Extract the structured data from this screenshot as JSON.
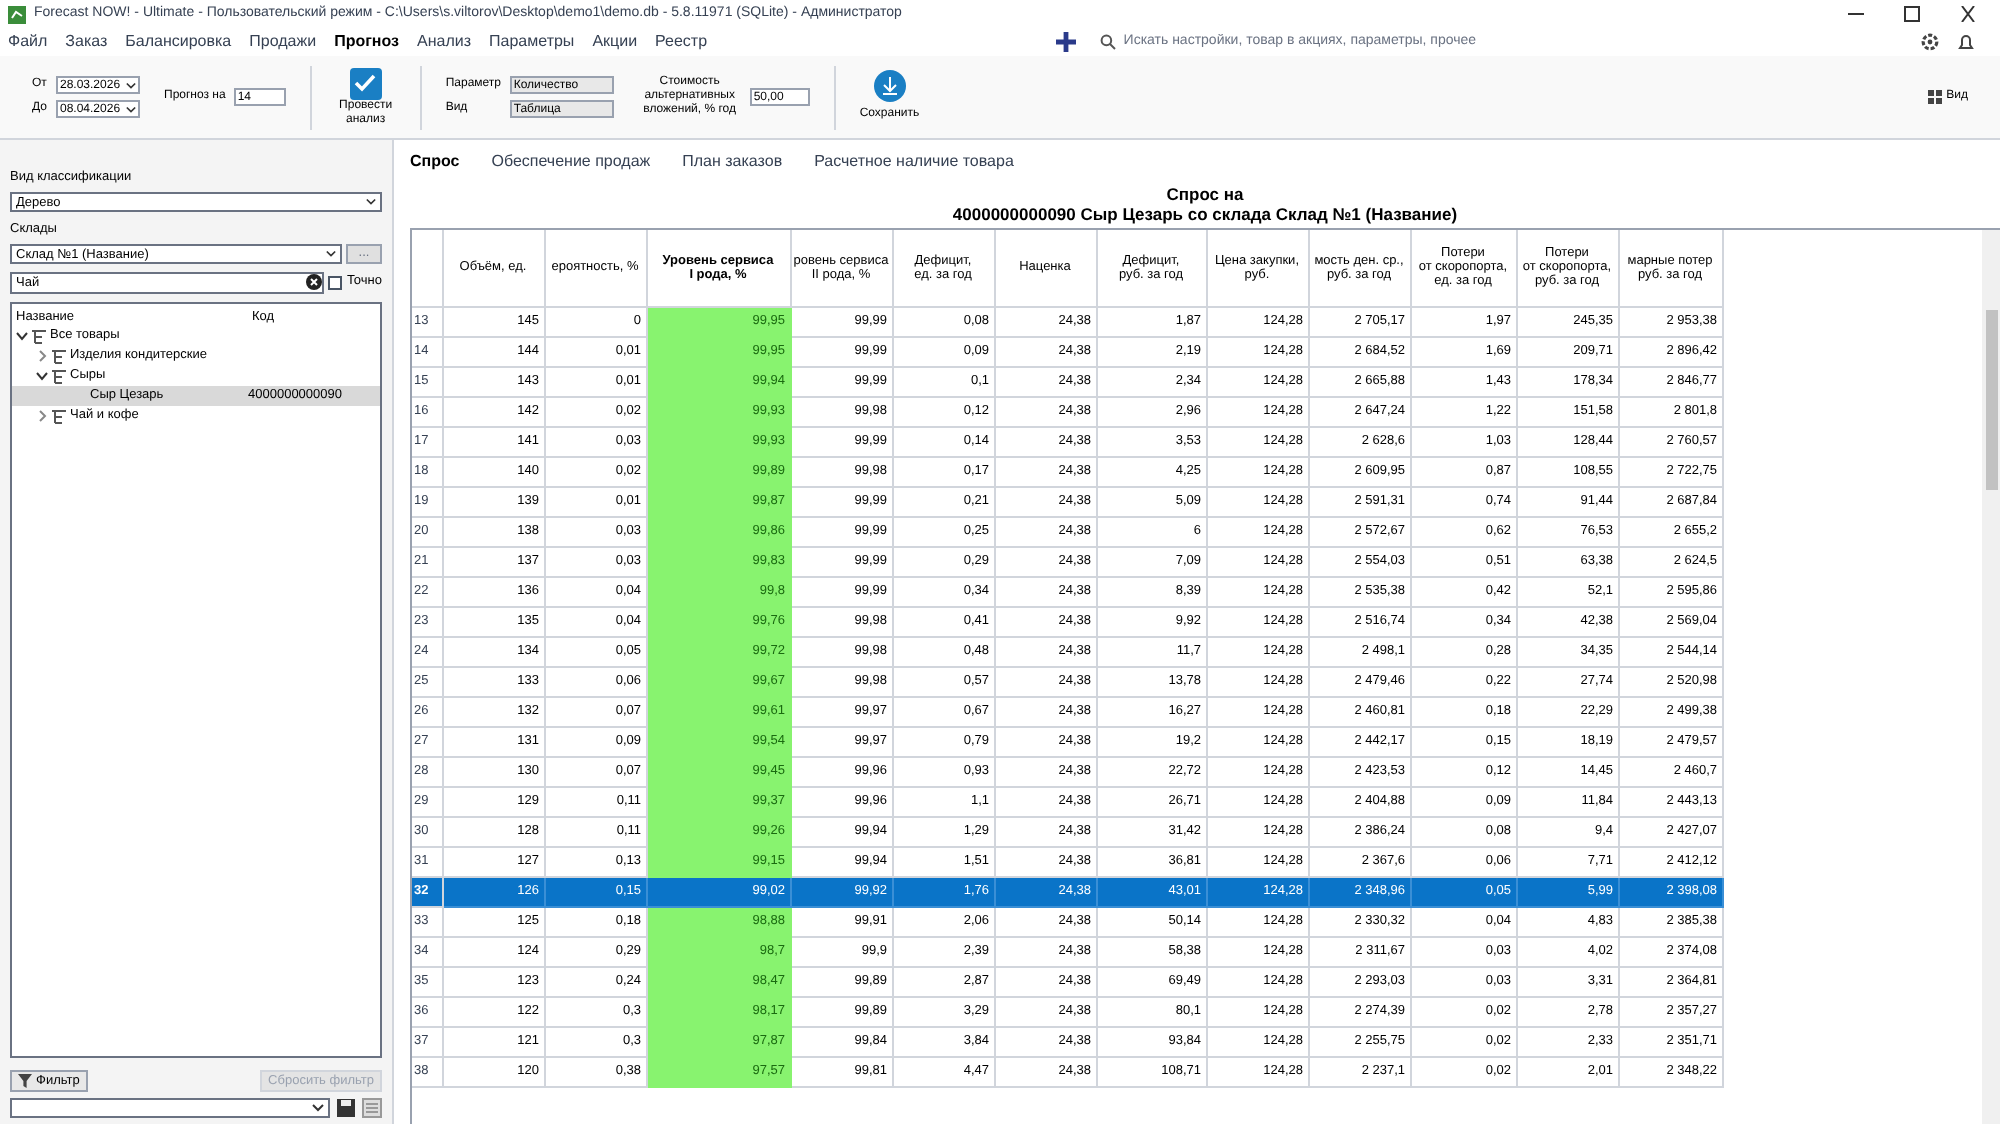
{
  "window": {
    "title": "Forecast NOW! - Ultimate - Пользовательский режим - C:\\Users\\s.viltorov\\Desktop\\demo1\\demo.db - 5.8.11971 (SQLite) - Администратор"
  },
  "menu": [
    {
      "label": "Файл",
      "selected": false
    },
    {
      "label": "Заказ",
      "selected": false
    },
    {
      "label": "Балансировка",
      "selected": false
    },
    {
      "label": "Продажи",
      "selected": false
    },
    {
      "label": "Прогноз",
      "selected": true
    },
    {
      "label": "Анализ",
      "selected": false
    },
    {
      "label": "Параметры",
      "selected": false
    },
    {
      "label": "Акции",
      "selected": false
    },
    {
      "label": "Реестр",
      "selected": false
    }
  ],
  "search": {
    "placeholder": "Искать настройки, товар в акциях, параметры, прочее"
  },
  "toolbar": {
    "from_label": "От",
    "from": "28.03.2026",
    "to_label": "До",
    "to": "08.04.2026",
    "forecast_label": "Прогноз на",
    "forecast": "14",
    "analyze": {
      "label": "Провести анализ",
      "checked": true
    },
    "param_label": "Параметр",
    "param": "Количество",
    "view_label": "Вид",
    "view": "Таблица",
    "rate_label": "Стоимость альтернативных вложений, % год",
    "rate": "50,00",
    "save": "Сохранить",
    "view_menu": "Вид"
  },
  "sidebar": {
    "classification_label": "Вид классификации",
    "classification": "Дерево",
    "warehouses_label": "Склады",
    "warehouse": "Склад №1 (Название)",
    "browse": "...",
    "filter_value": "Чай",
    "exact": {
      "label": "Точно",
      "checked": false
    },
    "tree_columns": [
      "Название",
      "Код"
    ],
    "tree": [
      {
        "name": "Все товары",
        "expanded": true,
        "selected": false,
        "children": [
          {
            "name": "Изделия кондитерские",
            "expanded": false,
            "selected": false
          },
          {
            "name": "Сыры",
            "expanded": true,
            "selected": false,
            "children": [
              {
                "name": "Сыр Цезарь",
                "code": "4000000000090",
                "selected": true
              }
            ]
          },
          {
            "name": "Чай и кофе",
            "expanded": false,
            "selected": false
          }
        ]
      }
    ],
    "filter_button": "Фильтр",
    "reset_button": {
      "label": "Сбросить фильтр",
      "disabled": true
    }
  },
  "tabs": [
    {
      "label": "Спрос",
      "selected": true
    },
    {
      "label": "Обеспечение продаж",
      "selected": false
    },
    {
      "label": "План заказов",
      "selected": false
    },
    {
      "label": "Расчетное наличие товара",
      "selected": false
    }
  ],
  "report_title": [
    "Спрос на",
    "4000000000090 Сыр Цезарь со склада Склад №1 (Название)"
  ],
  "table": {
    "columns": [
      {
        "label": "Объём, ед.",
        "highlighted": false
      },
      {
        "label": "ероятность, %",
        "highlighted": false
      },
      {
        "label": "Уровень сервиса\nI рода, %",
        "highlighted": true
      },
      {
        "label": "ровень сервиса\nII рода, %",
        "highlighted": false
      },
      {
        "label": "Дефицит,\nед. за год",
        "highlighted": false
      },
      {
        "label": "Наценка",
        "highlighted": false
      },
      {
        "label": "Дефицит,\nруб. за год",
        "highlighted": false
      },
      {
        "label": "Цена закупки,\nруб.",
        "highlighted": false
      },
      {
        "label": "мость ден. ср.,\nруб. за год",
        "highlighted": false
      },
      {
        "label": "Потери\nот скоропорта,\nед. за год",
        "highlighted": false
      },
      {
        "label": "Потери\nот скоропорта,\nруб. за год",
        "highlighted": false
      },
      {
        "label": "марные потер\nруб. за год",
        "highlighted": false
      }
    ],
    "rows": [
      {
        "number": "13",
        "selected": false,
        "cells": [
          "145",
          "0",
          "99,95",
          "99,99",
          "0,08",
          "24,38",
          "1,87",
          "124,28",
          "2 705,17",
          "1,97",
          "245,35",
          "2 953,38"
        ]
      },
      {
        "number": "14",
        "selected": false,
        "cells": [
          "144",
          "0,01",
          "99,95",
          "99,99",
          "0,09",
          "24,38",
          "2,19",
          "124,28",
          "2 684,52",
          "1,69",
          "209,71",
          "2 896,42"
        ]
      },
      {
        "number": "15",
        "selected": false,
        "cells": [
          "143",
          "0,01",
          "99,94",
          "99,99",
          "0,1",
          "24,38",
          "2,34",
          "124,28",
          "2 665,88",
          "1,43",
          "178,34",
          "2 846,77"
        ]
      },
      {
        "number": "16",
        "selected": false,
        "cells": [
          "142",
          "0,02",
          "99,93",
          "99,98",
          "0,12",
          "24,38",
          "2,96",
          "124,28",
          "2 647,24",
          "1,22",
          "151,58",
          "2 801,8"
        ]
      },
      {
        "number": "17",
        "selected": false,
        "cells": [
          "141",
          "0,03",
          "99,93",
          "99,99",
          "0,14",
          "24,38",
          "3,53",
          "124,28",
          "2 628,6",
          "1,03",
          "128,44",
          "2 760,57"
        ]
      },
      {
        "number": "18",
        "selected": false,
        "cells": [
          "140",
          "0,02",
          "99,89",
          "99,98",
          "0,17",
          "24,38",
          "4,25",
          "124,28",
          "2 609,95",
          "0,87",
          "108,55",
          "2 722,75"
        ]
      },
      {
        "number": "19",
        "selected": false,
        "cells": [
          "139",
          "0,01",
          "99,87",
          "99,99",
          "0,21",
          "24,38",
          "5,09",
          "124,28",
          "2 591,31",
          "0,74",
          "91,44",
          "2 687,84"
        ]
      },
      {
        "number": "20",
        "selected": false,
        "cells": [
          "138",
          "0,03",
          "99,86",
          "99,99",
          "0,25",
          "24,38",
          "6",
          "124,28",
          "2 572,67",
          "0,62",
          "76,53",
          "2 655,2"
        ]
      },
      {
        "number": "21",
        "selected": false,
        "cells": [
          "137",
          "0,03",
          "99,83",
          "99,99",
          "0,29",
          "24,38",
          "7,09",
          "124,28",
          "2 554,03",
          "0,51",
          "63,38",
          "2 624,5"
        ]
      },
      {
        "number": "22",
        "selected": false,
        "cells": [
          "136",
          "0,04",
          "99,8",
          "99,99",
          "0,34",
          "24,38",
          "8,39",
          "124,28",
          "2 535,38",
          "0,42",
          "52,1",
          "2 595,86"
        ]
      },
      {
        "number": "23",
        "selected": false,
        "cells": [
          "135",
          "0,04",
          "99,76",
          "99,98",
          "0,41",
          "24,38",
          "9,92",
          "124,28",
          "2 516,74",
          "0,34",
          "42,38",
          "2 569,04"
        ]
      },
      {
        "number": "24",
        "selected": false,
        "cells": [
          "134",
          "0,05",
          "99,72",
          "99,98",
          "0,48",
          "24,38",
          "11,7",
          "124,28",
          "2 498,1",
          "0,28",
          "34,35",
          "2 544,14"
        ]
      },
      {
        "number": "25",
        "selected": false,
        "cells": [
          "133",
          "0,06",
          "99,67",
          "99,98",
          "0,57",
          "24,38",
          "13,78",
          "124,28",
          "2 479,46",
          "0,22",
          "27,74",
          "2 520,98"
        ]
      },
      {
        "number": "26",
        "selected": false,
        "cells": [
          "132",
          "0,07",
          "99,61",
          "99,97",
          "0,67",
          "24,38",
          "16,27",
          "124,28",
          "2 460,81",
          "0,18",
          "22,29",
          "2 499,38"
        ]
      },
      {
        "number": "27",
        "selected": false,
        "cells": [
          "131",
          "0,09",
          "99,54",
          "99,97",
          "0,79",
          "24,38",
          "19,2",
          "124,28",
          "2 442,17",
          "0,15",
          "18,19",
          "2 479,57"
        ]
      },
      {
        "number": "28",
        "selected": false,
        "cells": [
          "130",
          "0,07",
          "99,45",
          "99,96",
          "0,93",
          "24,38",
          "22,72",
          "124,28",
          "2 423,53",
          "0,12",
          "14,45",
          "2 460,7"
        ]
      },
      {
        "number": "29",
        "selected": false,
        "cells": [
          "129",
          "0,11",
          "99,37",
          "99,96",
          "1,1",
          "24,38",
          "26,71",
          "124,28",
          "2 404,88",
          "0,09",
          "11,84",
          "2 443,13"
        ]
      },
      {
        "number": "30",
        "selected": false,
        "cells": [
          "128",
          "0,11",
          "99,26",
          "99,94",
          "1,29",
          "24,38",
          "31,42",
          "124,28",
          "2 386,24",
          "0,08",
          "9,4",
          "2 427,07"
        ]
      },
      {
        "number": "31",
        "selected": false,
        "cells": [
          "127",
          "0,13",
          "99,15",
          "99,94",
          "1,51",
          "24,38",
          "36,81",
          "124,28",
          "2 367,6",
          "0,06",
          "7,71",
          "2 412,12"
        ]
      },
      {
        "number": "32",
        "selected": true,
        "cells": [
          "126",
          "0,15",
          "99,02",
          "99,92",
          "1,76",
          "24,38",
          "43,01",
          "124,28",
          "2 348,96",
          "0,05",
          "5,99",
          "2 398,08"
        ]
      },
      {
        "number": "33",
        "selected": false,
        "cells": [
          "125",
          "0,18",
          "98,88",
          "99,91",
          "2,06",
          "24,38",
          "50,14",
          "124,28",
          "2 330,32",
          "0,04",
          "4,83",
          "2 385,38"
        ]
      },
      {
        "number": "34",
        "selected": false,
        "cells": [
          "124",
          "0,29",
          "98,7",
          "99,9",
          "2,39",
          "24,38",
          "58,38",
          "124,28",
          "2 311,67",
          "0,03",
          "4,02",
          "2 374,08"
        ]
      },
      {
        "number": "35",
        "selected": false,
        "cells": [
          "123",
          "0,24",
          "98,47",
          "99,89",
          "2,87",
          "24,38",
          "69,49",
          "124,28",
          "2 293,03",
          "0,03",
          "3,31",
          "2 364,81"
        ]
      },
      {
        "number": "36",
        "selected": false,
        "cells": [
          "122",
          "0,3",
          "98,17",
          "99,89",
          "3,29",
          "24,38",
          "80,1",
          "124,28",
          "2 274,39",
          "0,02",
          "2,78",
          "2 357,27"
        ]
      },
      {
        "number": "37",
        "selected": false,
        "cells": [
          "121",
          "0,3",
          "97,87",
          "99,84",
          "3,84",
          "24,38",
          "93,84",
          "124,28",
          "2 255,75",
          "0,02",
          "2,33",
          "2 351,71"
        ]
      },
      {
        "number": "38",
        "selected": false,
        "cells": [
          "120",
          "0,38",
          "97,57",
          "99,81",
          "4,47",
          "24,38",
          "108,71",
          "124,28",
          "2 237,1",
          "0,02",
          "2,01",
          "2 348,22"
        ]
      }
    ]
  }
}
